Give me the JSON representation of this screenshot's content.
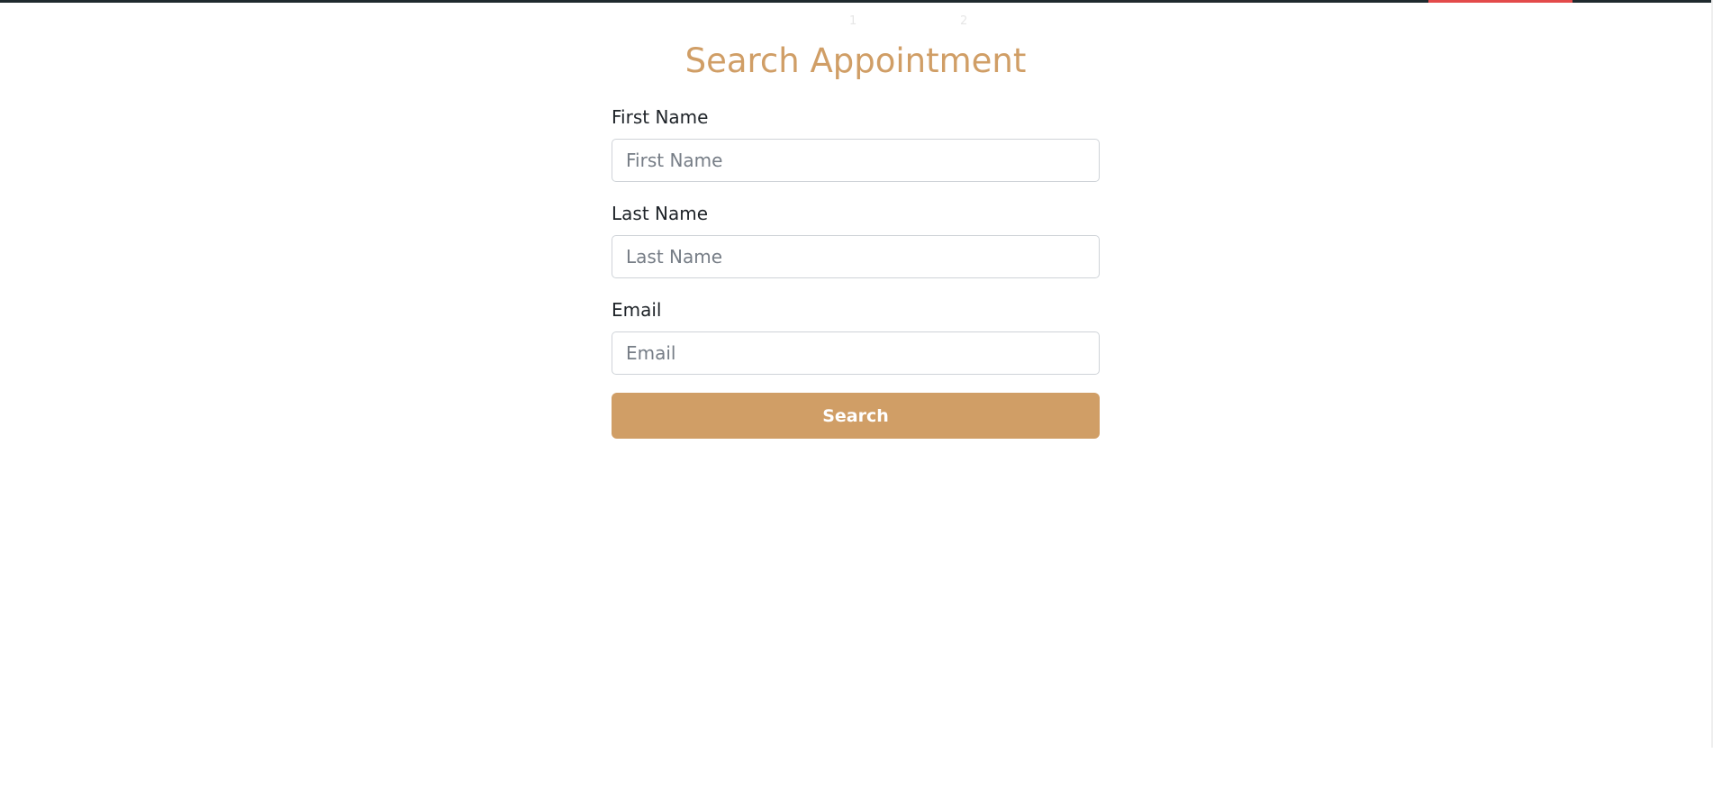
{
  "progress_steps": [
    "1",
    "2"
  ],
  "page": {
    "title": "Search Appointment"
  },
  "form": {
    "first_name": {
      "label": "First Name",
      "placeholder": "First Name",
      "value": ""
    },
    "last_name": {
      "label": "Last Name",
      "placeholder": "Last Name",
      "value": ""
    },
    "email": {
      "label": "Email",
      "placeholder": "Email",
      "value": ""
    },
    "submit_label": "Search"
  },
  "colors": {
    "accent": "#d09e66",
    "top_bar": "#1f2a2e",
    "top_accent": "#e34a4a"
  }
}
